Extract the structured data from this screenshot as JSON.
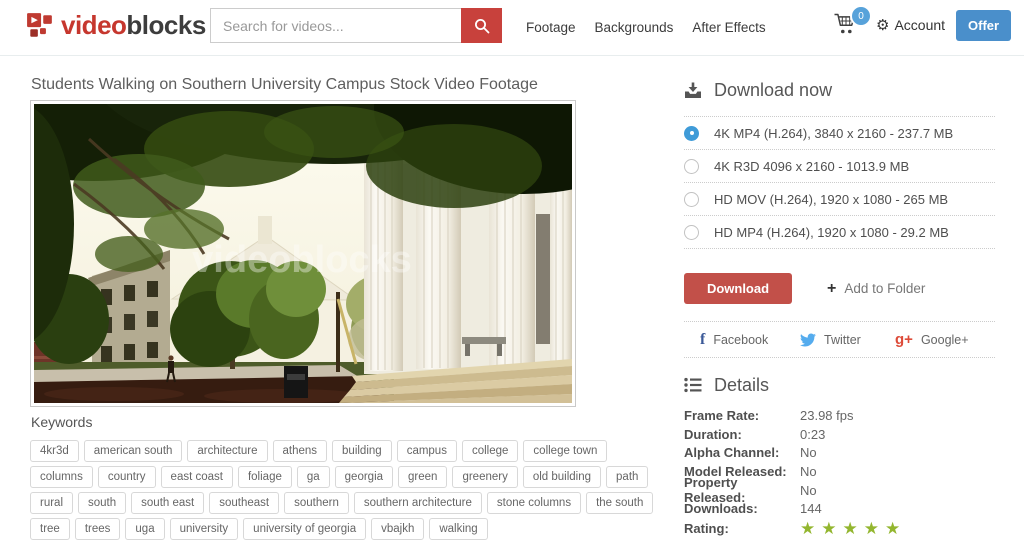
{
  "header": {
    "logo_video": "video",
    "logo_blocks": "blocks",
    "search_placeholder": "Search for videos...",
    "nav": [
      {
        "label": "Footage"
      },
      {
        "label": "Backgrounds"
      },
      {
        "label": "After Effects"
      }
    ],
    "cart_count": "0",
    "account_label": "Account",
    "offer_label": "Offer"
  },
  "main": {
    "title": "Students Walking on Southern University Campus Stock Video Footage",
    "watermark": "videoblocks",
    "keywords_label": "Keywords",
    "keywords": [
      "4kr3d",
      "american south",
      "architecture",
      "athens",
      "building",
      "campus",
      "college",
      "college town",
      "columns",
      "country",
      "east coast",
      "foliage",
      "ga",
      "georgia",
      "green",
      "greenery",
      "old building",
      "path",
      "rural",
      "south",
      "south east",
      "southeast",
      "southern",
      "southern architecture",
      "stone columns",
      "the south",
      "tree",
      "trees",
      "uga",
      "university",
      "university of georgia",
      "vbajkh",
      "walking"
    ]
  },
  "sidebar": {
    "download_heading": "Download now",
    "options": [
      {
        "label": "4K MP4 (H.264), 3840 x 2160 - 237.7 MB",
        "selected": true
      },
      {
        "label": "4K R3D 4096 x 2160 - 1013.9 MB",
        "selected": false
      },
      {
        "label": "HD MOV (H.264), 1920 x 1080 - 265 MB",
        "selected": false
      },
      {
        "label": "HD MP4 (H.264), 1920 x 1080 - 29.2 MB",
        "selected": false
      }
    ],
    "download_button": "Download",
    "add_to_folder_label": "Add to Folder",
    "social": [
      {
        "label": "Facebook"
      },
      {
        "label": "Twitter"
      },
      {
        "label": "Google+"
      }
    ],
    "details_heading": "Details",
    "details": [
      {
        "label": "Frame Rate:",
        "value": "23.98 fps"
      },
      {
        "label": "Duration:",
        "value": "0:23"
      },
      {
        "label": "Alpha Channel:",
        "value": "No"
      },
      {
        "label": "Model Released:",
        "value": "No"
      },
      {
        "label": "Property Released:",
        "value": "No"
      },
      {
        "label": "Downloads:",
        "value": "144"
      }
    ],
    "rating_label": "Rating:",
    "rating_stars": [
      "★",
      "★",
      "★",
      "★",
      "★"
    ]
  },
  "colors": {
    "brand_red": "#c6372e",
    "button_red": "#c25049",
    "offer_blue": "#4a8fcb",
    "radio_blue": "#3f9bd8",
    "badge_blue": "#57a2da",
    "star_green": "#93b62f",
    "facebook_blue": "#3b5998",
    "twitter_blue": "#55acee",
    "google_red": "#dd4b39"
  }
}
